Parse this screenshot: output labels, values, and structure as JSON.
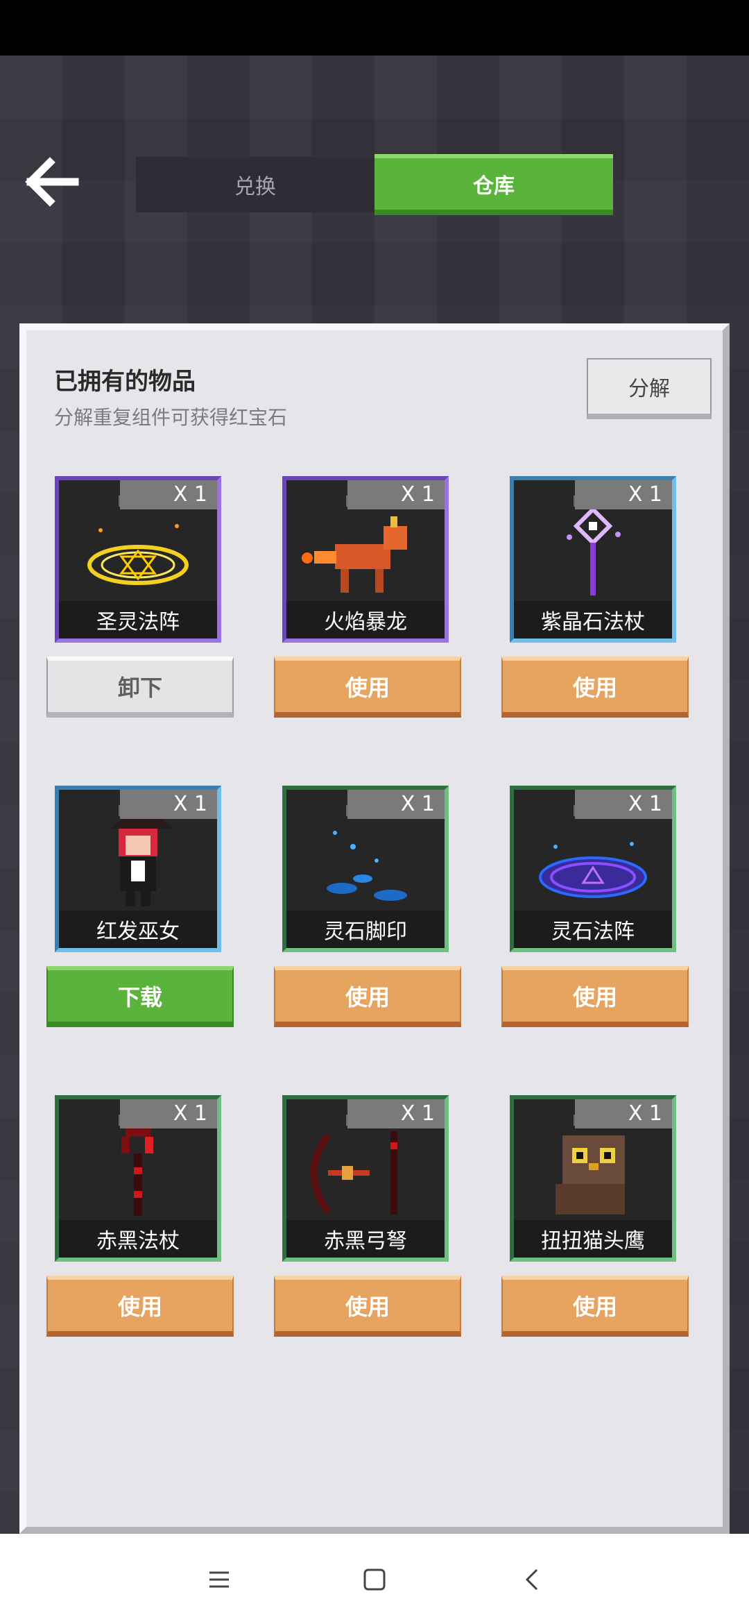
{
  "header": {
    "tabs": [
      {
        "label": "兑换",
        "active": false
      },
      {
        "label": "仓库",
        "active": true
      }
    ]
  },
  "panel": {
    "title": "已拥有的物品",
    "subtitle": "分解重复组件可获得红宝石",
    "decompose_label": "分解"
  },
  "items": [
    {
      "name": "圣灵法阵",
      "count": "X 1",
      "action": "卸下",
      "rarity": "purple"
    },
    {
      "name": "火焰暴龙",
      "count": "X 1",
      "action": "使用",
      "rarity": "purple"
    },
    {
      "name": "紫晶石法杖",
      "count": "X 1",
      "action": "使用",
      "rarity": "blue"
    },
    {
      "name": "红发巫女",
      "count": "X 1",
      "action": "下载",
      "rarity": "blue"
    },
    {
      "name": "灵石脚印",
      "count": "X 1",
      "action": "使用",
      "rarity": "green"
    },
    {
      "name": "灵石法阵",
      "count": "X 1",
      "action": "使用",
      "rarity": "green"
    },
    {
      "name": "赤黑法杖",
      "count": "X 1",
      "action": "使用",
      "rarity": "green"
    },
    {
      "name": "赤黑弓弩",
      "count": "X 1",
      "action": "使用",
      "rarity": "green"
    },
    {
      "name": "扭扭猫头鹰",
      "count": "X 1",
      "action": "使用",
      "rarity": "green"
    }
  ],
  "colors": {
    "accent_green": "#5ab43c",
    "use_orange": "#e6a460",
    "panel_bg": "#e6e6ea"
  }
}
